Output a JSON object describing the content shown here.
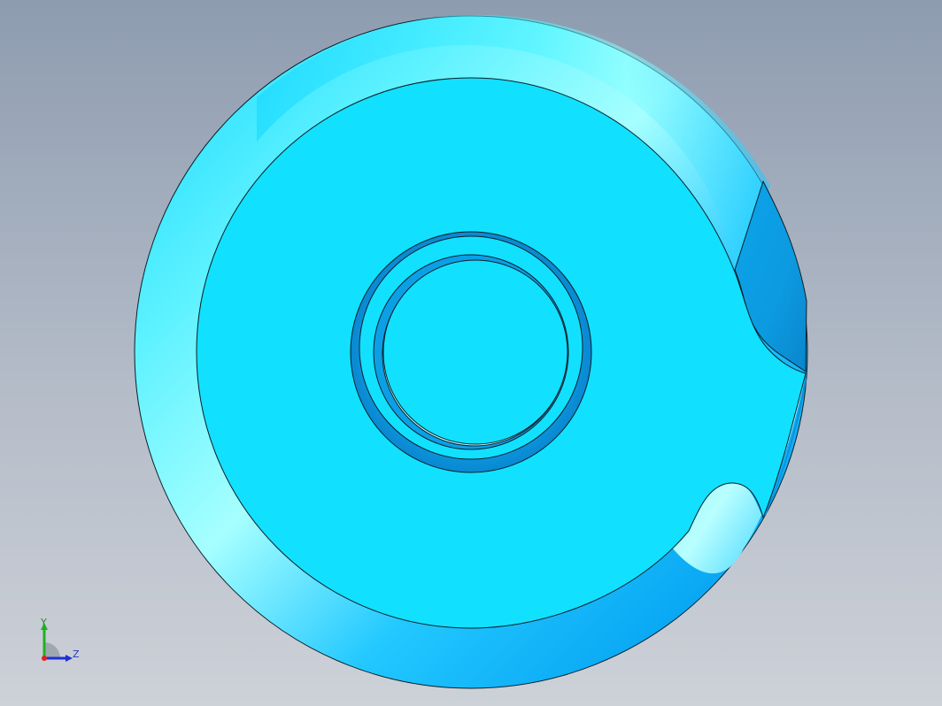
{
  "viewport": {
    "background_top": "#8e9cb0",
    "background_bottom": "#cdd1d8",
    "model": {
      "part_color": "#12e0ff",
      "shade_dark": "#0aa8ea",
      "shade_light": "#c8ffff",
      "edge_color": "#0b1f2a"
    }
  },
  "triad": {
    "y_label": "Y",
    "z_label": "Z",
    "y_color": "#22b022",
    "z_color": "#1f2fd6",
    "x_color": "#e02020"
  }
}
